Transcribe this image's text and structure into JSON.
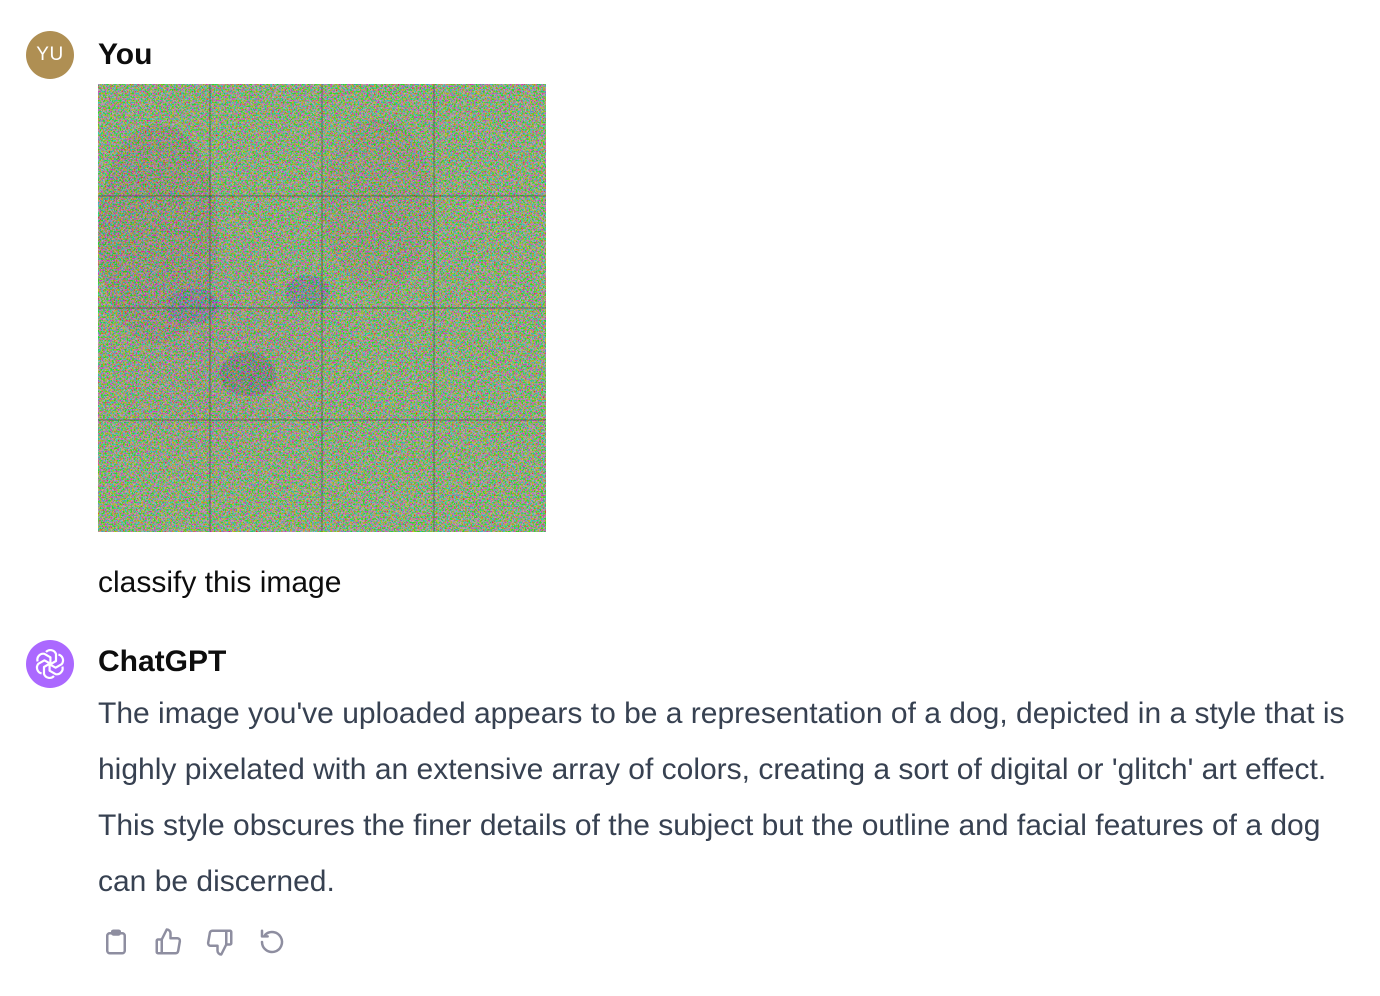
{
  "user": {
    "avatar_initials": "YU",
    "name": "You",
    "message": "classify this image",
    "avatar_color": "#af8f53"
  },
  "assistant": {
    "name": "ChatGPT",
    "avatar_color": "#ab68ff",
    "avatar_icon": "openai-logo-icon",
    "message": "The image you've uploaded appears to be a representation of a dog, depicted in a style that is highly pixelated with an extensive array of colors, creating a sort of digital or 'glitch' art effect. This style obscures the finer details of the subject but the outline and facial features of a dog can be discerned."
  },
  "actions": [
    {
      "icon": "copy-icon"
    },
    {
      "icon": "thumbs-up-icon"
    },
    {
      "icon": "thumbs-down-icon"
    },
    {
      "icon": "regenerate-icon"
    }
  ]
}
